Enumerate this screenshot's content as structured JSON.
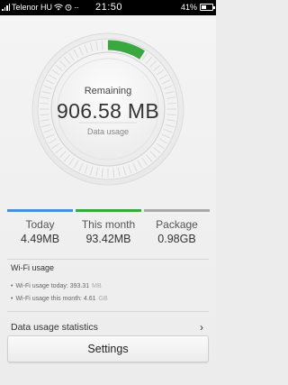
{
  "status_bar": {
    "carrier": "Telenor HU",
    "time": "21:50",
    "battery": "41%",
    "battery_level": 0.41
  },
  "gauge": {
    "label": "Remaining",
    "value": "906.58 MB",
    "sublabel": "Data usage",
    "used_fraction": 0.09,
    "accent_color": "#3aa83f"
  },
  "stats": [
    {
      "label": "Today",
      "value": "4.49MB",
      "color": "#4a90d9"
    },
    {
      "label": "This month",
      "value": "93.42MB",
      "color": "#3aa83f"
    },
    {
      "label": "Package",
      "value": "0.98GB",
      "color": "#a9a9a9"
    }
  ],
  "wifi": {
    "title": "Wi-Fi usage",
    "items": [
      {
        "text": "Wi-Fi usage today: 393.31",
        "unit": "MB"
      },
      {
        "text": "Wi-Fi usage this month: 4.61",
        "unit": "GB"
      }
    ]
  },
  "stats_link": {
    "label": "Data usage statistics"
  },
  "settings_button": {
    "label": "Settings"
  }
}
